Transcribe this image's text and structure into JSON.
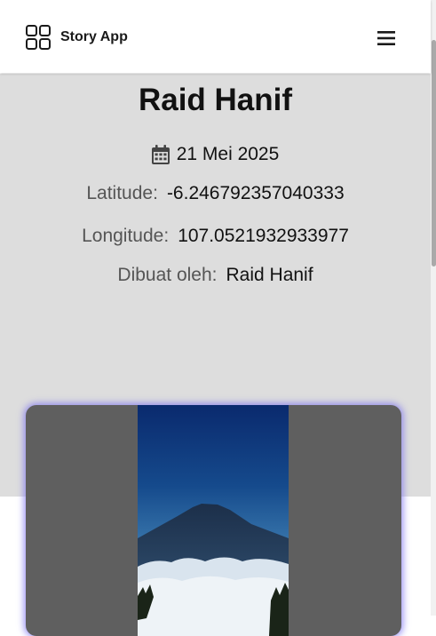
{
  "navbar": {
    "brand_icon": "grid-icon",
    "brand_name": "Story App",
    "menu_icon": "hamburger-icon"
  },
  "story": {
    "title": "Raid Hanif",
    "date_icon": "calendar-icon",
    "date": "21 Mei 2025",
    "latitude_label": "Latitude:",
    "latitude": "-6.246792357040333",
    "longitude_label": "Longitude:",
    "longitude": "107.0521932933977",
    "author_label": "Dibuat oleh:",
    "author": "Raid Hanif"
  },
  "colors": {
    "hero_background": "#dddddd",
    "image_card_background": "#5f5f5f",
    "image_glow": "#7a6ef0"
  }
}
